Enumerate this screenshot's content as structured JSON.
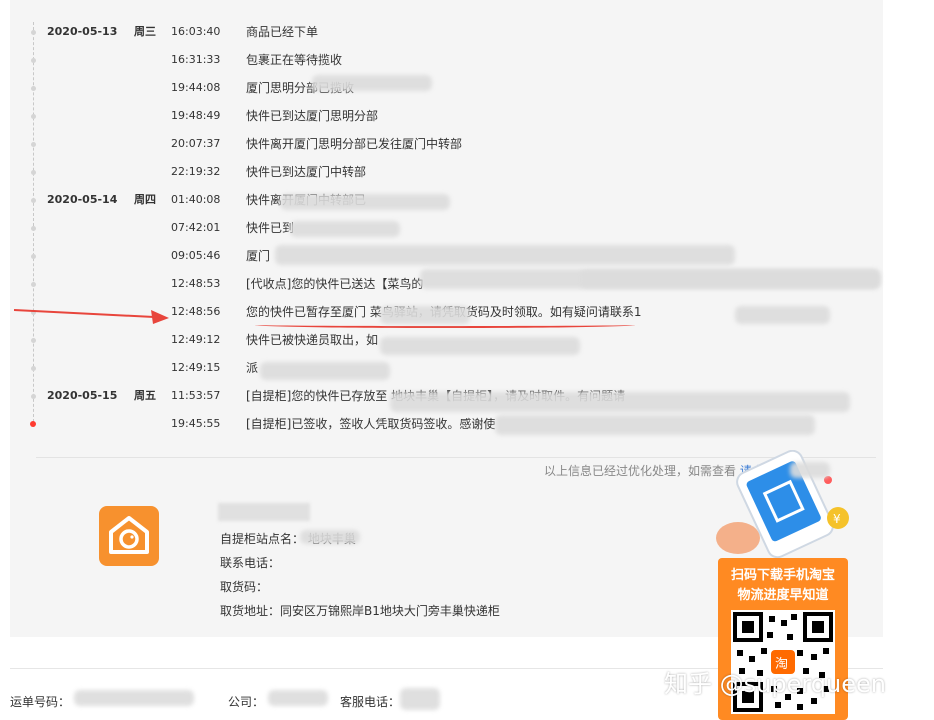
{
  "colors": {
    "accent_orange": "#f7912e",
    "link_blue": "#3a7bd5",
    "alert_red": "#e8453c",
    "panel_bg": "#f5f5f5"
  },
  "tracking": [
    {
      "date": "2020-05-13",
      "weekday": "周三",
      "time": "16:03:40",
      "desc": "商品已经下单"
    },
    {
      "date": "",
      "weekday": "",
      "time": "16:31:33",
      "desc": "包裹正在等待揽收"
    },
    {
      "date": "",
      "weekday": "",
      "time": "19:44:08",
      "desc": "厦门思明分部已揽收"
    },
    {
      "date": "",
      "weekday": "",
      "time": "19:48:49",
      "desc": "快件已到达厦门思明分部"
    },
    {
      "date": "",
      "weekday": "",
      "time": "20:07:37",
      "desc": "快件离开厦门思明分部已发往厦门中转部"
    },
    {
      "date": "",
      "weekday": "",
      "time": "22:19:32",
      "desc": "快件已到达厦门中转部"
    },
    {
      "date": "2020-05-14",
      "weekday": "周四",
      "time": "01:40:08",
      "desc": "快件离开厦门中转部已"
    },
    {
      "date": "",
      "weekday": "",
      "time": "07:42:01",
      "desc": "快件已到"
    },
    {
      "date": "",
      "weekday": "",
      "time": "09:05:46",
      "desc": "厦门"
    },
    {
      "date": "",
      "weekday": "",
      "time": "12:48:53",
      "desc": "[代收点]您的快件已送达【菜鸟的"
    },
    {
      "date": "",
      "weekday": "",
      "time": "12:48:56",
      "desc": "您的快件已暂存至厦门                    菜鸟驿站，请凭取货码及时领取。如有疑问请联系1"
    },
    {
      "date": "",
      "weekday": "",
      "time": "12:49:12",
      "desc": "快件已被快递员取出，如"
    },
    {
      "date": "",
      "weekday": "",
      "time": "12:49:15",
      "desc": "派"
    },
    {
      "date": "2020-05-15",
      "weekday": "周五",
      "time": "11:53:57",
      "desc": "[自提柜]您的快件已存放至              地块丰巢【自提柜】，请及时取件。有问题请"
    },
    {
      "date": "",
      "weekday": "",
      "time": "19:45:55",
      "desc": "[自提柜]已签收，签收人凭取货码签收。感谢使"
    }
  ],
  "optimization_note": "以上信息已经过优化处理，如需查看",
  "optimization_link": "请点击",
  "station": {
    "name_line": "自提柜站点名：               地块丰巢",
    "phone_line": "联系电话：",
    "code_line": "取货码：",
    "address_line": "取货地址：同安区万锦熙岸B1地块大门旁丰巢快递柜"
  },
  "bottom": {
    "waybill_label": "运单号码：",
    "company_label": "公司：",
    "service_label": "客服电话："
  },
  "ad": {
    "line1": "扫码下载手机淘宝",
    "line2": "物流进度早知道"
  },
  "watermark": "知乎 @superqueen"
}
